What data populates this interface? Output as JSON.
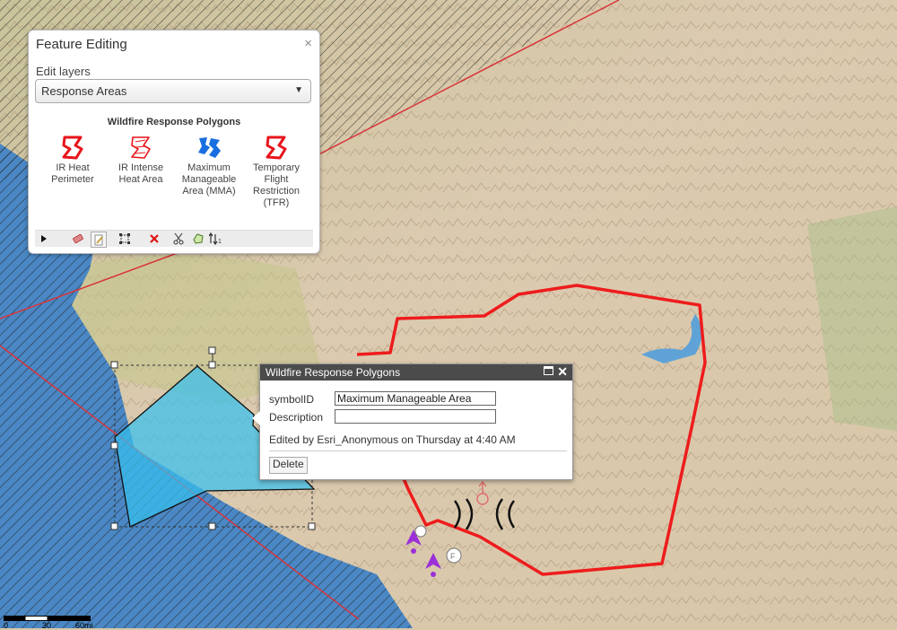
{
  "feature_editing": {
    "title": "Feature Editing",
    "close_glyph": "×",
    "edit_layers_label": "Edit layers",
    "selected_layer": "Response Areas",
    "template_group_title": "Wildfire Response Polygons",
    "templates": [
      {
        "label": "IR Heat Perimeter",
        "icon": "ir-heat-perimeter-icon",
        "color": "#e8141b"
      },
      {
        "label": "IR Intense Heat Area",
        "icon": "ir-intense-heat-icon",
        "color": "#e8141b"
      },
      {
        "label": "Maximum Manageable Area (MMA)",
        "icon": "maximum-manageable-area-icon",
        "color": "#1a6fe0"
      },
      {
        "label": "Temporary Flight Restriction (TFR)",
        "icon": "temporary-flight-restriction-icon",
        "color": "#e8141b"
      }
    ],
    "toolbar": [
      "select-arrow-icon",
      "eraser-icon",
      "edit-pencil-icon",
      "reshape-vertices-icon",
      "delete-x-icon",
      "cut-scissors-icon",
      "reshape-icon",
      "attributes-icon"
    ]
  },
  "popup": {
    "title": "Wildfire Response Polygons",
    "fields": [
      {
        "label": "symbolID",
        "value": "Maximum Manageable Area"
      },
      {
        "label": "Description",
        "value": ""
      }
    ],
    "edited_text": "Edited by Esri_Anonymous on Thursday at 4:40 AM",
    "delete_label": "Delete"
  },
  "scalebar": {
    "labels": [
      "0",
      "30",
      "60mi"
    ]
  },
  "colors": {
    "perimeter_red": "#ee1c1c",
    "mma_fill": "#37c1ef",
    "ocean": "#4a87c4",
    "tfr_red": "#d9343a",
    "marker_purple": "#9b30d8"
  }
}
